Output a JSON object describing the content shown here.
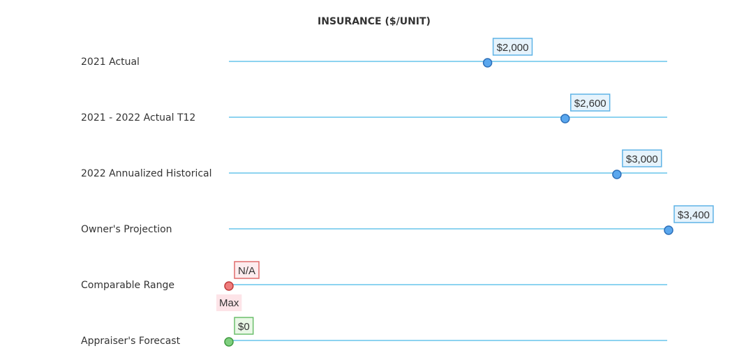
{
  "chart_data": {
    "type": "scatter",
    "title": "INSURANCE ($/UNIT)",
    "xlim": [
      0,
      3400
    ],
    "grid": false,
    "rows": [
      {
        "label": "2021 Actual",
        "value": 2000,
        "value_label": "$2,000",
        "kind": "actual"
      },
      {
        "label": "2021 - 2022 Actual T12",
        "value": 2600,
        "value_label": "$2,600",
        "kind": "actual"
      },
      {
        "label": "2022 Annualized Historical",
        "value": 3000,
        "value_label": "$3,000",
        "kind": "actual"
      },
      {
        "label": "Owner's Projection",
        "value": 3400,
        "value_label": "$3,400",
        "kind": "actual"
      },
      {
        "label": "Comparable Range",
        "value": 0,
        "value_label": "N/A",
        "sub_label": "Max",
        "kind": "comparable"
      },
      {
        "label": "Appraiser's Forecast",
        "value": 0,
        "value_label": "$0",
        "kind": "forecast"
      }
    ]
  },
  "colors": {
    "line": "#8dd3f0",
    "actual_fill": "#5aa7ee",
    "actual_stroke": "#2d6fb8",
    "actual_box_fill": "#e6f3fc",
    "actual_box_stroke": "#5fb3e6",
    "comparable_fill": "#ee7d7d",
    "comparable_stroke": "#c03a3a",
    "comparable_box_fill": "#fdecee",
    "comparable_box_stroke": "#e06c6c",
    "comparable_sub_fill": "#fde4e8",
    "forecast_fill": "#7fcf7f",
    "forecast_stroke": "#3f9a3f",
    "forecast_box_fill": "#e9f7e6",
    "forecast_box_stroke": "#6cbf6c",
    "text": "#333333"
  }
}
